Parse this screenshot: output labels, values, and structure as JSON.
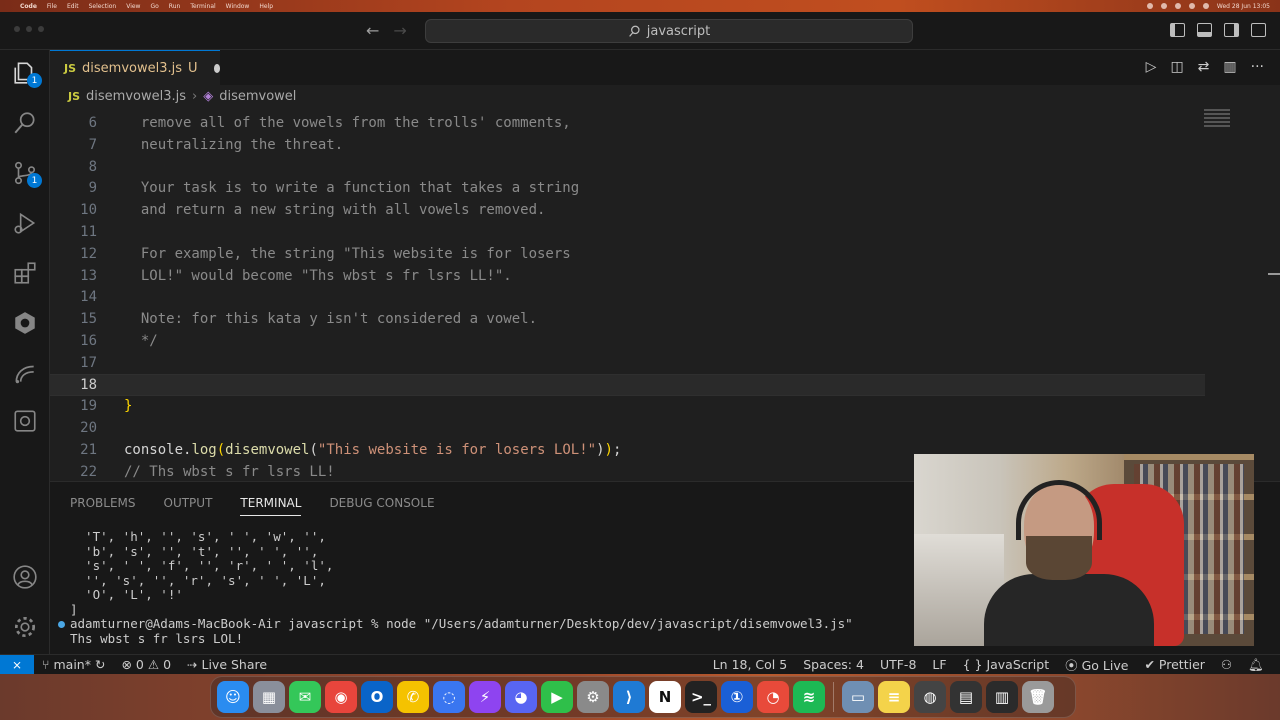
{
  "menubar": {
    "app": "Code",
    "items": [
      "File",
      "Edit",
      "Selection",
      "View",
      "Go",
      "Run",
      "Terminal",
      "Window",
      "Help"
    ],
    "clock": "Wed 28 Jun 13:05"
  },
  "titlebar": {
    "search_text": "javascript"
  },
  "activity": {
    "explorer_badge": "1",
    "scm_badge": "1"
  },
  "tab": {
    "icon": "JS",
    "filename": "disemvowel3.js",
    "status": "U"
  },
  "breadcrumb": {
    "icon": "JS",
    "file": "disemvowel3.js",
    "symbol": "disemvowel",
    "separator": "›"
  },
  "editor": {
    "lines": [
      {
        "num": "6",
        "segments": [
          {
            "t": "comment",
            "v": "  remove all of the vowels from the trolls' comments,"
          }
        ]
      },
      {
        "num": "7",
        "segments": [
          {
            "t": "comment",
            "v": "  neutralizing the threat."
          }
        ]
      },
      {
        "num": "8",
        "segments": []
      },
      {
        "num": "9",
        "segments": [
          {
            "t": "comment",
            "v": "  Your task is to write a function that takes a string"
          }
        ]
      },
      {
        "num": "10",
        "segments": [
          {
            "t": "comment",
            "v": "  and return a new string with all vowels removed."
          }
        ]
      },
      {
        "num": "11",
        "segments": []
      },
      {
        "num": "12",
        "segments": [
          {
            "t": "comment",
            "v": "  For example, the string \"This website is for losers"
          }
        ]
      },
      {
        "num": "13",
        "segments": [
          {
            "t": "comment",
            "v": "  LOL!\" would become \"Ths wbst s fr lsrs LL!\"."
          }
        ]
      },
      {
        "num": "14",
        "segments": []
      },
      {
        "num": "15",
        "segments": [
          {
            "t": "comment",
            "v": "  Note: for this kata y isn't considered a vowel."
          }
        ]
      },
      {
        "num": "16",
        "segments": [
          {
            "t": "comment",
            "v": "  */"
          }
        ]
      },
      {
        "num": "17",
        "segments": []
      },
      {
        "num": "18",
        "segments": []
      },
      {
        "num": "19",
        "segments": [
          {
            "t": "brace",
            "v": "}"
          }
        ]
      },
      {
        "num": "20",
        "segments": []
      },
      {
        "num": "21",
        "segments": [
          {
            "t": "plain",
            "v": "console."
          },
          {
            "t": "fn",
            "v": "log"
          },
          {
            "t": "brace",
            "v": "("
          },
          {
            "t": "fn",
            "v": "disemvowel"
          },
          {
            "t": "plain",
            "v": "("
          },
          {
            "t": "str",
            "v": "\"This website is for losers LOL!\""
          },
          {
            "t": "plain",
            "v": ")"
          },
          {
            "t": "brace",
            "v": ")"
          },
          {
            "t": "plain",
            "v": ";"
          }
        ]
      },
      {
        "num": "22",
        "segments": [
          {
            "t": "comment",
            "v": "// Ths wbst s fr lsrs LL!"
          }
        ]
      }
    ],
    "current_line": "18"
  },
  "panel": {
    "tabs": [
      "PROBLEMS",
      "OUTPUT",
      "TERMINAL",
      "DEBUG CONSOLE"
    ],
    "active_tab": "TERMINAL",
    "terminal_lines": [
      "  'T', 'h', '', 's', ' ', 'w', '',",
      "  'b', 's', '', 't', '', ' ', '',",
      "  's', ' ', 'f', '', 'r', ' ', 'l',",
      "  '', 's', '', 'r', 's', ' ', 'L',",
      "  'O', 'L', '!'",
      "]"
    ],
    "prompt": "adamturner@Adams-MacBook-Air javascript % node \"/Users/adamturner/Desktop/dev/javascript/disemvowel3.js\"",
    "output": "Ths wbst s fr lsrs LOL!"
  },
  "statusbar": {
    "branch": "main*",
    "errors": "0",
    "warnings": "0",
    "live_share": "Live Share",
    "position": "Ln 18, Col 5",
    "spaces": "Spaces: 4",
    "encoding": "UTF-8",
    "eol": "LF",
    "language": "JavaScript",
    "go_live": "Go Live",
    "prettier": "Prettier"
  },
  "dock": {
    "apps": [
      {
        "name": "Finder",
        "color": "#2a8cf0",
        "glyph": "☺"
      },
      {
        "name": "Launchpad",
        "color": "#8a8f9b",
        "glyph": "▦"
      },
      {
        "name": "Messages",
        "color": "#34c759",
        "glyph": "✉"
      },
      {
        "name": "Chrome",
        "color": "#e8453c",
        "glyph": "◉"
      },
      {
        "name": "Outlook",
        "color": "#0a64c8",
        "glyph": "O"
      },
      {
        "name": "WhatsApp",
        "color": "#f5c200",
        "glyph": "✆"
      },
      {
        "name": "Signal",
        "color": "#3a76f0",
        "glyph": "◌"
      },
      {
        "name": "Messenger",
        "color": "#8e44f0",
        "glyph": "⚡"
      },
      {
        "name": "Discord",
        "color": "#5865f2",
        "glyph": "◕"
      },
      {
        "name": "FaceTime",
        "color": "#2fbf4a",
        "glyph": "▶"
      },
      {
        "name": "Settings",
        "color": "#8a8a8a",
        "glyph": "⚙"
      },
      {
        "name": "VS Code",
        "color": "#1f7ad4",
        "glyph": "⟩"
      },
      {
        "name": "Notion",
        "color": "#ffffff",
        "glyph": "N"
      },
      {
        "name": "Terminal",
        "color": "#222222",
        "glyph": ">_"
      },
      {
        "name": "1Password",
        "color": "#1a5fd6",
        "glyph": "①"
      },
      {
        "name": "Focus",
        "color": "#e84a3a",
        "glyph": "◔"
      },
      {
        "name": "Spotify",
        "color": "#1db954",
        "glyph": "≋"
      }
    ],
    "recents": [
      {
        "name": "Preview",
        "color": "#6f8fb3",
        "glyph": "▭"
      },
      {
        "name": "Notes",
        "color": "#f4d34a",
        "glyph": "≡"
      },
      {
        "name": "Activity",
        "color": "#444",
        "glyph": "◍"
      },
      {
        "name": "Window",
        "color": "#333",
        "glyph": "▤"
      },
      {
        "name": "Window2",
        "color": "#2b2b2b",
        "glyph": "▥"
      },
      {
        "name": "Trash",
        "color": "#9a9a9a",
        "glyph": "🗑"
      }
    ]
  }
}
